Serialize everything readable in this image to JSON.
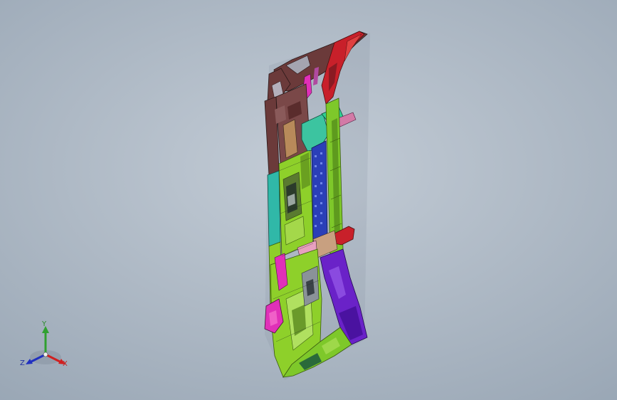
{
  "viewport": {
    "background_top": "#c3ccd6",
    "background_bottom": "#94a2b1"
  },
  "model": {
    "icon": "cad-assembly-icon",
    "part_colors": {
      "frame_dark_red": "#6b3a3a",
      "red": "#c8202a",
      "green": "#8ed02a",
      "teal": "#3cc4a0",
      "cyan": "#30c0b0",
      "blue_stack": "#2a3fb8",
      "purple": "#6a22c8",
      "magenta": "#e030b8",
      "pink": "#d8508a",
      "tan": "#b88a5a"
    }
  },
  "triad": {
    "icon": "coordinate-triad-icon",
    "x_label": "X",
    "y_label": "Y",
    "z_label": "Z",
    "x_color": "#d02020",
    "y_color": "#30a030",
    "z_color": "#2030c0"
  }
}
